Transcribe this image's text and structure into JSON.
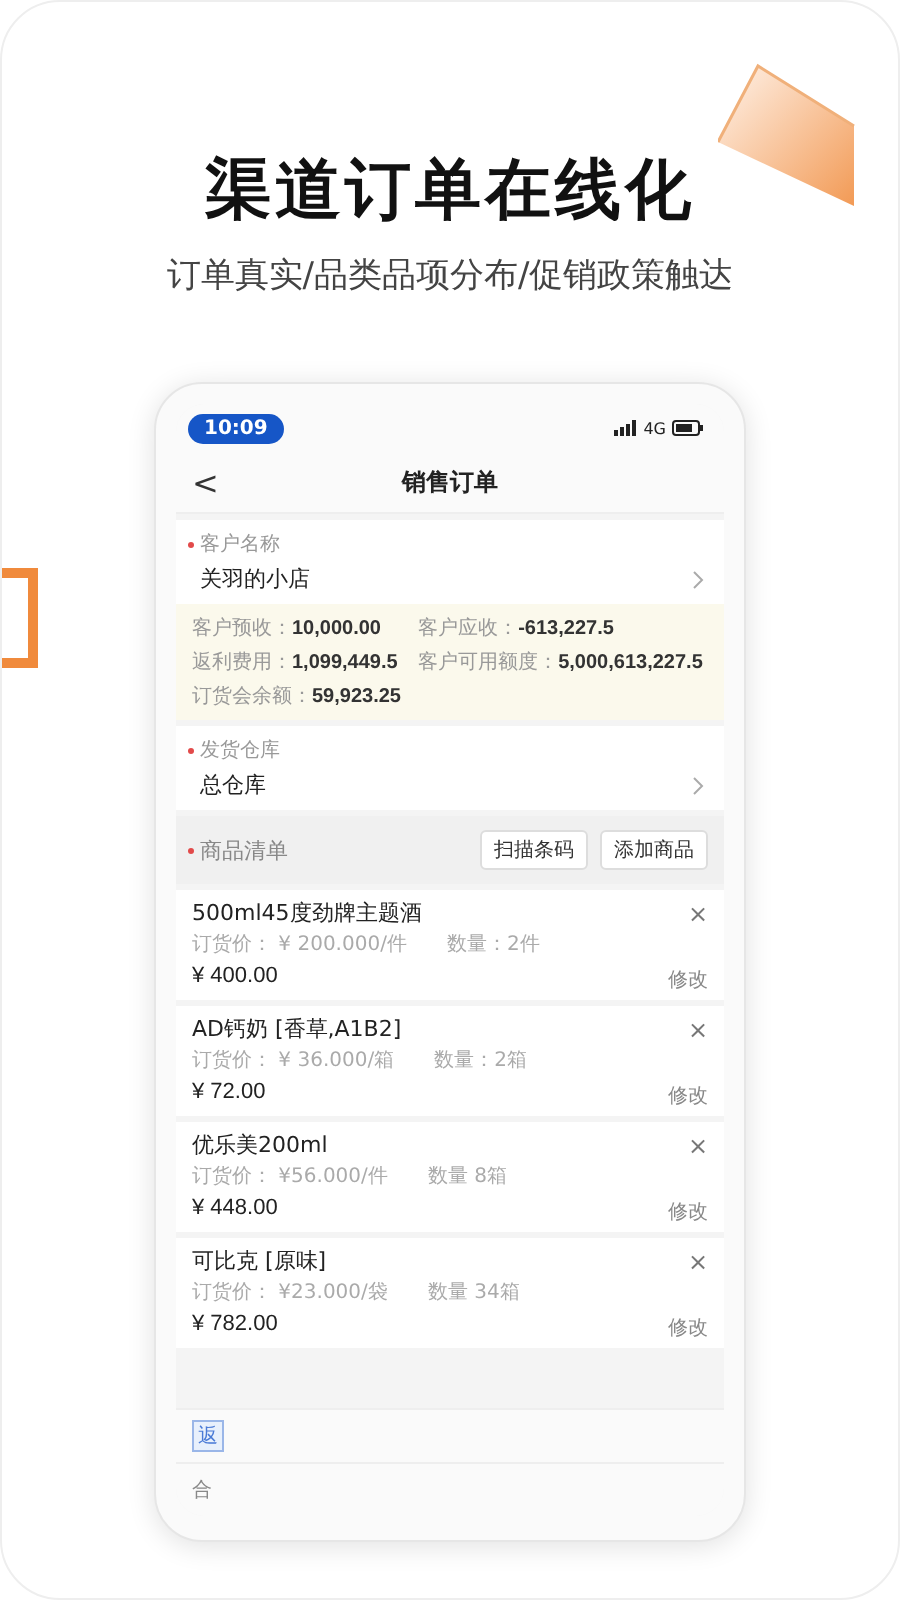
{
  "headline": "渠道订单在线化",
  "subtitle": "订单真实/品类品项分布/促销政策触达",
  "status_bar": {
    "time": "10:09",
    "network": "4G"
  },
  "nav": {
    "back": "<",
    "title": "销售订单"
  },
  "customer": {
    "label": "客户名称",
    "required": true,
    "value": "关羽的小店"
  },
  "balances": [
    {
      "label": "客户预收：",
      "value": "10,000.00"
    },
    {
      "label": "客户应收：",
      "value": "-613,227.5"
    },
    {
      "label": "返利费用：",
      "value": "1,099,449.5"
    },
    {
      "label": "客户可用额度：",
      "value": "5,000,613,227.5"
    },
    {
      "label": "订货会余额：",
      "value": "59,923.25"
    }
  ],
  "warehouse": {
    "label": "发货仓库",
    "required": true,
    "value": "总仓库"
  },
  "goods": {
    "label": "商品清单",
    "required": true,
    "buttons": [
      "扫描条码",
      "添加商品"
    ]
  },
  "items": [
    {
      "name": "500ml45度劲牌主题酒",
      "price": "订货价： ¥ 200.000/件",
      "qty": "数量：2件",
      "total": "¥ 400.00",
      "edit": "修改",
      "remove": "×"
    },
    {
      "name": "AD钙奶 [香草,A1B2]",
      "price": "订货价： ¥ 36.000/箱",
      "qty": "数量：2箱",
      "total": "¥ 72.00",
      "edit": "修改",
      "remove": "×"
    },
    {
      "name": "优乐美200ml",
      "price": "订货价： ¥56.000/件",
      "qty": "数量  8箱",
      "total": "¥ 448.00",
      "edit": "修改",
      "remove": "×"
    },
    {
      "name": "可比克 [原味]",
      "price": "订货价： ¥23.000/袋",
      "qty": "数量  34箱",
      "total": "¥ 782.00",
      "edit": "修改",
      "remove": "×"
    }
  ],
  "footer": {
    "badge": "返",
    "total_label": "合"
  }
}
